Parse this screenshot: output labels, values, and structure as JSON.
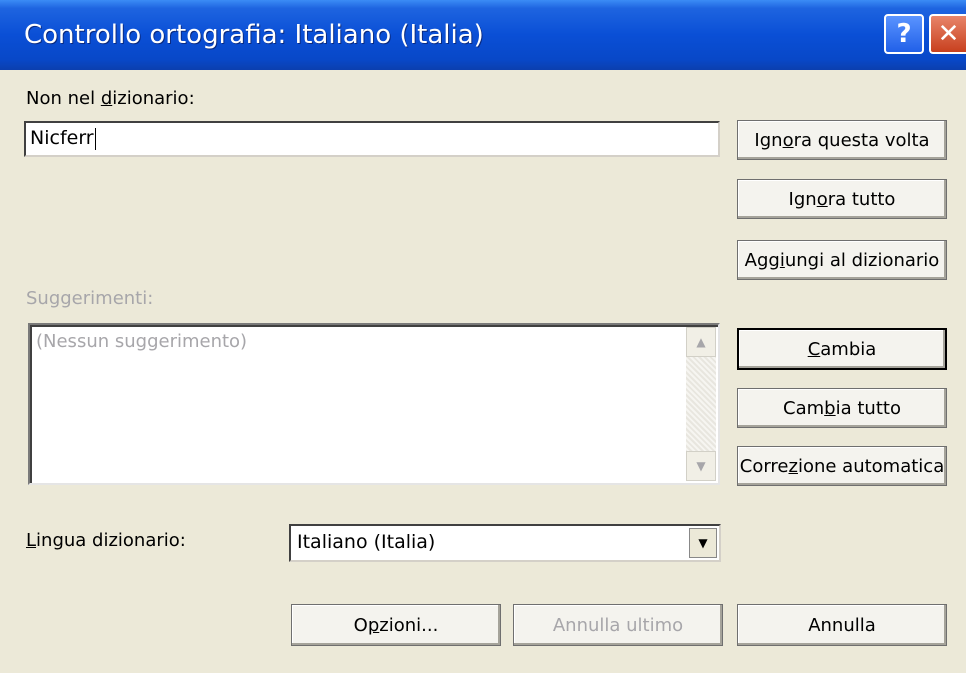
{
  "window": {
    "title": "Controllo ortografia: Italiano (Italia)",
    "help_glyph": "?",
    "close_glyph": "✕"
  },
  "not_in_dictionary": {
    "label_pre": "Non nel ",
    "label_u": "d",
    "label_post": "izionario:",
    "value": "Nicferr"
  },
  "suggestions": {
    "label": "Suggerimenti:",
    "placeholder": "(Nessun suggerimento)"
  },
  "buttons": {
    "ignore_once": {
      "pre": "Ign",
      "u": "o",
      "post": "ra questa volta"
    },
    "ignore_all": {
      "pre": "Ign",
      "u": "o",
      "post": "ra tutto"
    },
    "add_dictionary": {
      "pre": "Agg",
      "u": "i",
      "post": "ungi al dizionario"
    },
    "change": {
      "pre": "",
      "u": "C",
      "post": "ambia"
    },
    "change_all": {
      "pre": "Cam",
      "u": "b",
      "post": "ia tutto"
    },
    "autocorrect": {
      "pre": "Corre",
      "u": "z",
      "post": "ione automatica"
    },
    "options": {
      "pre": "O",
      "u": "p",
      "post": "zioni..."
    },
    "undo_last": "Annulla ultimo",
    "cancel": "Annulla"
  },
  "language": {
    "label_u": "L",
    "label_post": "ingua dizionario:",
    "value": "Italiano (Italia)"
  }
}
